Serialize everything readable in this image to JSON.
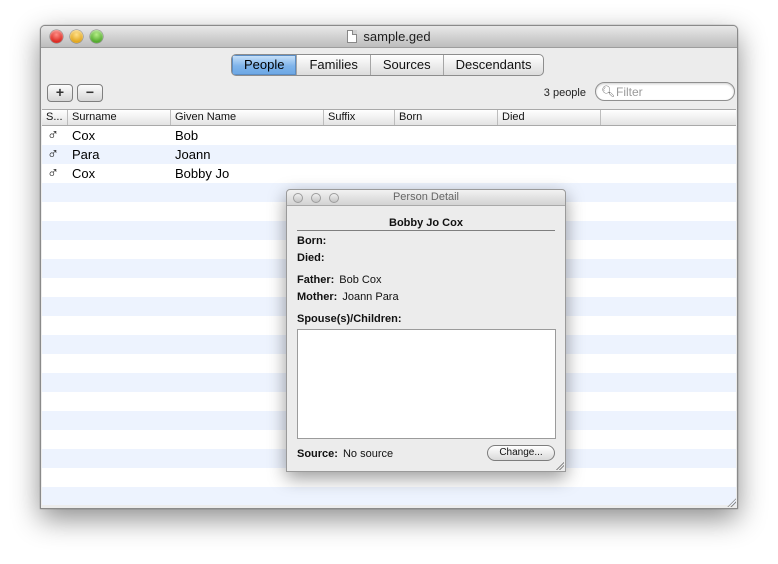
{
  "window": {
    "title": "sample.ged"
  },
  "tabs": [
    {
      "label": "People",
      "selected": true
    },
    {
      "label": "Families",
      "selected": false
    },
    {
      "label": "Sources",
      "selected": false
    },
    {
      "label": "Descendants",
      "selected": false
    }
  ],
  "toolbar": {
    "add_label": "+",
    "remove_label": "−"
  },
  "count_text": "3 people",
  "filter": {
    "placeholder": "Filter",
    "value": ""
  },
  "table": {
    "columns": [
      "S...",
      "Surname",
      "Given Name",
      "Suffix",
      "Born",
      "Died"
    ],
    "rows": [
      {
        "sex_icon": "♂",
        "surname": "Cox",
        "given": "Bob",
        "suffix": "",
        "born": "",
        "died": ""
      },
      {
        "sex_icon": "♂",
        "surname": "Para",
        "given": "Joann",
        "suffix": "",
        "born": "",
        "died": ""
      },
      {
        "sex_icon": "♂",
        "surname": "Cox",
        "given": "Bobby Jo",
        "suffix": "",
        "born": "",
        "died": ""
      }
    ]
  },
  "detail": {
    "title": "Person Detail",
    "name": "Bobby Jo Cox",
    "born_label": "Born:",
    "born_value": "",
    "died_label": "Died:",
    "died_value": "",
    "father_label": "Father:",
    "father_value": "Bob Cox",
    "mother_label": "Mother:",
    "mother_value": "Joann Para",
    "spouses_label": "Spouse(s)/Children:",
    "source_label": "Source:",
    "source_value": "No source",
    "change_label": "Change..."
  },
  "colors": {
    "accent": "#7fb4ea",
    "row_stripe": "#edf3fe"
  }
}
